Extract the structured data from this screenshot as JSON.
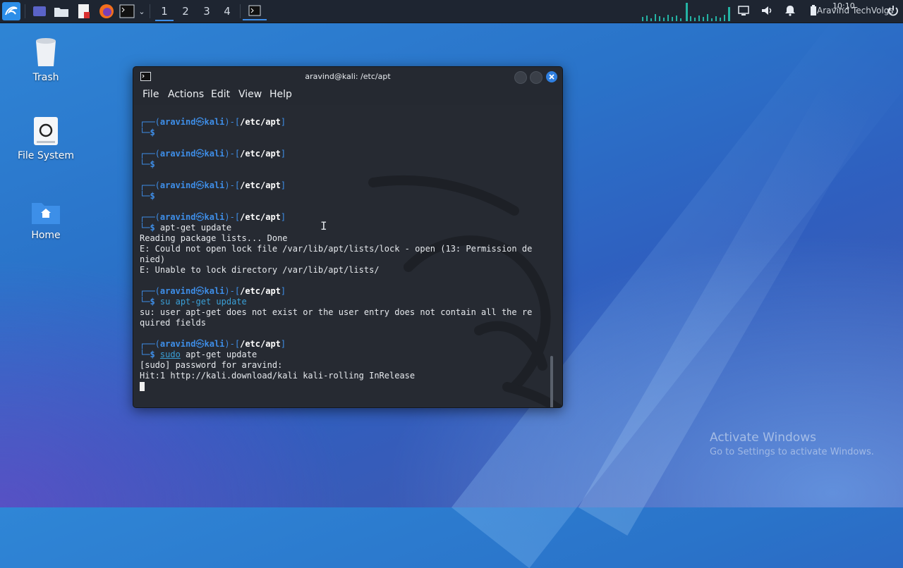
{
  "taskbar": {
    "workspaces": [
      "1",
      "2",
      "3",
      "4"
    ],
    "active_workspace": "1",
    "tray_overlay_text": "Aravind TechVolgs",
    "clock": "10:10"
  },
  "desktop": {
    "icons": [
      {
        "label": "Trash",
        "icon": "trash-icon"
      },
      {
        "label": "File System",
        "icon": "drive-icon"
      },
      {
        "label": "Home",
        "icon": "home-folder-icon"
      }
    ]
  },
  "terminal": {
    "title": "aravind@kali: /etc/apt",
    "menu": [
      "File",
      "Actions",
      "Edit",
      "View",
      "Help"
    ],
    "prompt": {
      "user": "aravind",
      "host": "kali",
      "path": "/etc/apt",
      "symbol": "$"
    },
    "lines": {
      "l6_cmd": "apt-get update",
      "l7": "Reading package lists... Done",
      "l8": "E: Could not open lock file /var/lib/apt/lists/lock - open (13: Permission de",
      "l9": "nied)",
      "l10": "E: Unable to lock directory /var/lib/apt/lists/",
      "l12_cmd": "su apt-get update",
      "l13": "su: user apt-get does not exist or the user entry does not contain all the re",
      "l14": "quired fields",
      "l16_sudo": "sudo",
      "l16_cmd": " apt-get update",
      "l17": "[sudo] password for aravind:",
      "l18": "Hit:1 http://kali.download/kali kali-rolling InRelease"
    }
  },
  "watermark": {
    "title": "Activate Windows",
    "subtitle": "Go to Settings to activate Windows."
  }
}
